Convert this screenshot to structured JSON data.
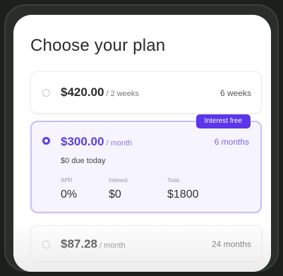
{
  "header": {
    "title": "Choose your plan"
  },
  "plans": [
    {
      "price": "$420.00",
      "period": "/ 2 weeks",
      "term": "6 weeks",
      "selected": false
    },
    {
      "price": "$300.00",
      "period": "/ month",
      "term": "6 months",
      "selected": true,
      "badge": "Interest free",
      "due_today": "$0 due today",
      "stats": [
        {
          "label": "APR",
          "value": "0%"
        },
        {
          "label": "Interest",
          "value": "$0"
        },
        {
          "label": "Total",
          "value": "$1800"
        }
      ]
    },
    {
      "price": "$87.28",
      "period": "/ month",
      "term": "24 months",
      "selected": false
    }
  ],
  "colors": {
    "accent": "#5a3fe0",
    "badge": "#5b36ea",
    "background": "#1c201c"
  }
}
